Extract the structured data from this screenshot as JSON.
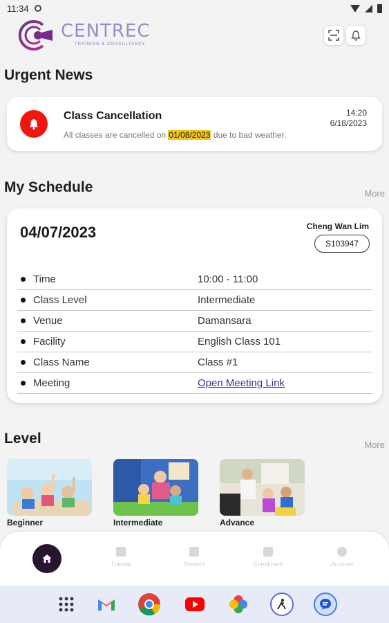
{
  "status_bar": {
    "time": "11:34"
  },
  "header": {
    "brand_name": "CENTREC",
    "brand_tagline": "TRAINING & CONSULTANCY"
  },
  "urgent_news": {
    "title": "Urgent News",
    "card": {
      "title": "Class Cancellation",
      "body_prefix": "All classes are cancelled on ",
      "body_highlight": "01/08/2023",
      "body_suffix": " due to bad weather.",
      "time": "14:20",
      "date": "6/18/2023"
    }
  },
  "schedule": {
    "title": "My Schedule",
    "more_label": "More",
    "date": "04/07/2023",
    "student_name": "Cheng Wan Lim",
    "student_id": "S103947",
    "rows": [
      {
        "label": "Time",
        "value": "10:00 - 11:00"
      },
      {
        "label": "Class Level",
        "value": "Intermediate"
      },
      {
        "label": "Venue",
        "value": "Damansara"
      },
      {
        "label": "Facility",
        "value": "English Class 101"
      },
      {
        "label": "Class Name",
        "value": "Class #1"
      },
      {
        "label": "Meeting",
        "value": "Open Meeting Link"
      }
    ]
  },
  "level": {
    "title": "Level",
    "more_label": "More",
    "items": [
      {
        "label": "Beginner"
      },
      {
        "label": "Intermediate"
      },
      {
        "label": "Advance"
      }
    ]
  },
  "bottom_nav": {
    "items": [
      {
        "label": "Tutorial"
      },
      {
        "label": "Student"
      },
      {
        "label": "Enrollment"
      },
      {
        "label": "Account"
      }
    ]
  },
  "colors": {
    "accent": "#2a1530",
    "alert": "#f0150f",
    "highlight": "#f5c518",
    "brand": "#9b8cc8"
  }
}
